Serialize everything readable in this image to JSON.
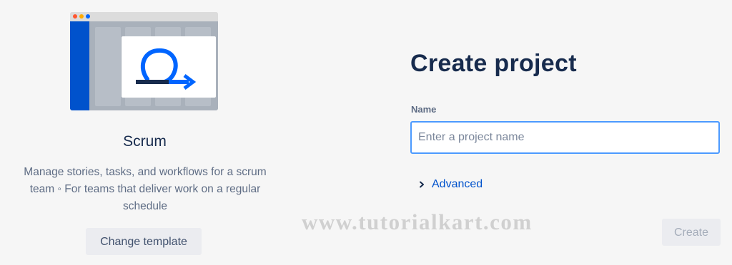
{
  "template": {
    "title": "Scrum",
    "description": "Manage stories, tasks, and workflows for a scrum team ◦ For teams that deliver work on a regular schedule",
    "change_button_label": "Change template",
    "illustration_icon": "scrum-cycle-icon"
  },
  "form": {
    "title": "Create project",
    "name_label": "Name",
    "name_value": "",
    "name_placeholder": "Enter a project name",
    "advanced_label": "Advanced",
    "create_button_label": "Create"
  },
  "watermark": "www.tutorialkart.com",
  "colors": {
    "brand_blue": "#0052cc",
    "focus_border": "#4c9aff",
    "heading_text": "#172b4d",
    "muted_text": "#5e6c84"
  }
}
